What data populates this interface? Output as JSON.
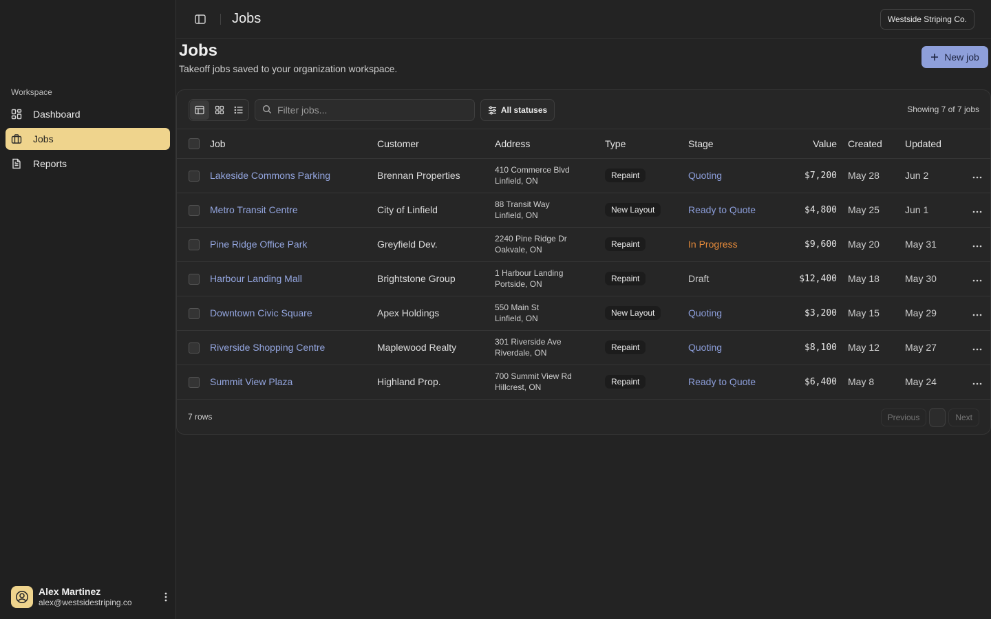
{
  "sidebar": {
    "group_label": "Workspace",
    "items": [
      {
        "label": "Dashboard",
        "icon": "dashboard-icon",
        "active": false
      },
      {
        "label": "Jobs",
        "icon": "briefcase-icon",
        "active": true
      },
      {
        "label": "Reports",
        "icon": "file-text-icon",
        "active": false
      }
    ],
    "user": {
      "name": "Alex Martinez",
      "email": "alex@westsidestriping.co"
    }
  },
  "topbar": {
    "title": "Jobs",
    "org": "Westside Striping Co."
  },
  "page": {
    "title": "Jobs",
    "subtitle": "Takeoff jobs saved to your organization workspace.",
    "new_button": "New job"
  },
  "toolbar": {
    "filter_placeholder": "Filter jobs...",
    "status_filter": "All statuses",
    "showing": "Showing 7 of 7 jobs"
  },
  "table": {
    "columns": [
      "Job",
      "Customer",
      "Address",
      "Type",
      "Stage",
      "Value",
      "Created",
      "Updated"
    ],
    "rows": [
      {
        "job": "Lakeside Commons Parking",
        "customer": "Brennan Properties",
        "addr1": "410 Commerce Blvd",
        "addr2": "Linfield, ON",
        "type": "Repaint",
        "stage": "Quoting",
        "value": "$7,200",
        "created": "May 28",
        "updated": "Jun 2"
      },
      {
        "job": "Metro Transit Centre",
        "customer": "City of Linfield",
        "addr1": "88 Transit Way",
        "addr2": "Linfield, ON",
        "type": "New Layout",
        "stage": "Ready to Quote",
        "value": "$4,800",
        "created": "May 25",
        "updated": "Jun 1"
      },
      {
        "job": "Pine Ridge Office Park",
        "customer": "Greyfield Dev.",
        "addr1": "2240 Pine Ridge Dr",
        "addr2": "Oakvale, ON",
        "type": "Repaint",
        "stage": "In Progress",
        "value": "$9,600",
        "created": "May 20",
        "updated": "May 31"
      },
      {
        "job": "Harbour Landing Mall",
        "customer": "Brightstone Group",
        "addr1": "1 Harbour Landing",
        "addr2": "Portside, ON",
        "type": "Repaint",
        "stage": "Draft",
        "value": "$12,400",
        "created": "May 18",
        "updated": "May 30"
      },
      {
        "job": "Downtown Civic Square",
        "customer": "Apex Holdings",
        "addr1": "550 Main St",
        "addr2": "Linfield, ON",
        "type": "New Layout",
        "stage": "Quoting",
        "value": "$3,200",
        "created": "May 15",
        "updated": "May 29"
      },
      {
        "job": "Riverside Shopping Centre",
        "customer": "Maplewood Realty",
        "addr1": "301 Riverside Ave",
        "addr2": "Riverdale, ON",
        "type": "Repaint",
        "stage": "Quoting",
        "value": "$8,100",
        "created": "May 12",
        "updated": "May 27"
      },
      {
        "job": "Summit View Plaza",
        "customer": "Highland Prop.",
        "addr1": "700 Summit View Rd",
        "addr2": "Hillcrest, ON",
        "type": "Repaint",
        "stage": "Ready to Quote",
        "value": "$6,400",
        "created": "May 8",
        "updated": "May 24"
      }
    ]
  },
  "stage_colors": {
    "Quoting": "#8d9fdc",
    "Ready to Quote": "#8d9fdc",
    "In Progress": "#e58a3a",
    "Draft": "#c9c9c9"
  },
  "footer": {
    "rows": "7 rows",
    "previous": "Previous",
    "next": "Next"
  },
  "colors": {
    "accent": "#8e9fda",
    "active_nav": "#efd48d",
    "link": "#94a6e0"
  }
}
